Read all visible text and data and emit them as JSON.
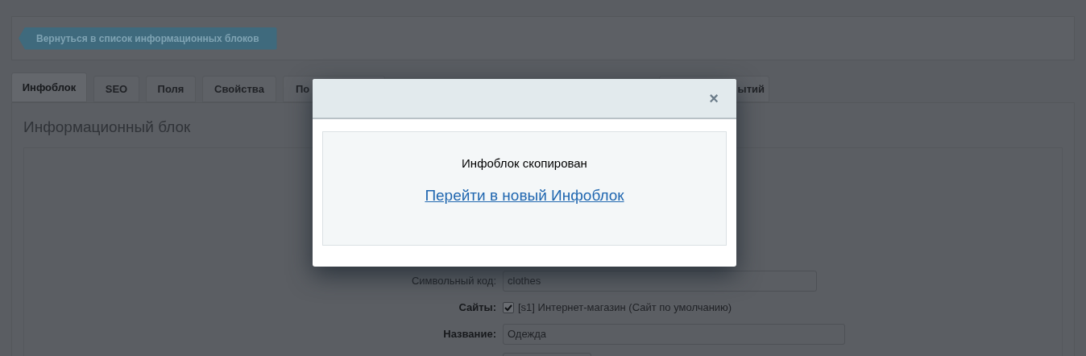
{
  "back_button": "Вернуться в список информационных блоков",
  "tabs": [
    {
      "label": "Инфоблок",
      "selected": true
    },
    {
      "label": "SEO",
      "selected": false
    },
    {
      "label": "Поля",
      "selected": false
    },
    {
      "label": "Свойства",
      "selected": false
    },
    {
      "label": "По",
      "selected": false
    },
    {
      "label": "ытий",
      "selected": false
    }
  ],
  "section_title": "Информационный блок",
  "form": [
    {
      "label": "Символьный код:",
      "kind": "text",
      "bold": false,
      "value": "clothes"
    },
    {
      "label": "Сайты:",
      "kind": "checkbox",
      "bold": true,
      "checked": true,
      "value": "[s1] Интернет-магазин (Сайт по умолчанию)"
    },
    {
      "label": "Название:",
      "kind": "text",
      "bold": true,
      "value": "Одежда"
    }
  ],
  "modal": {
    "message": "Инфоблок скопирован",
    "link": "Перейти в новый Инфоблок",
    "close": "×"
  }
}
